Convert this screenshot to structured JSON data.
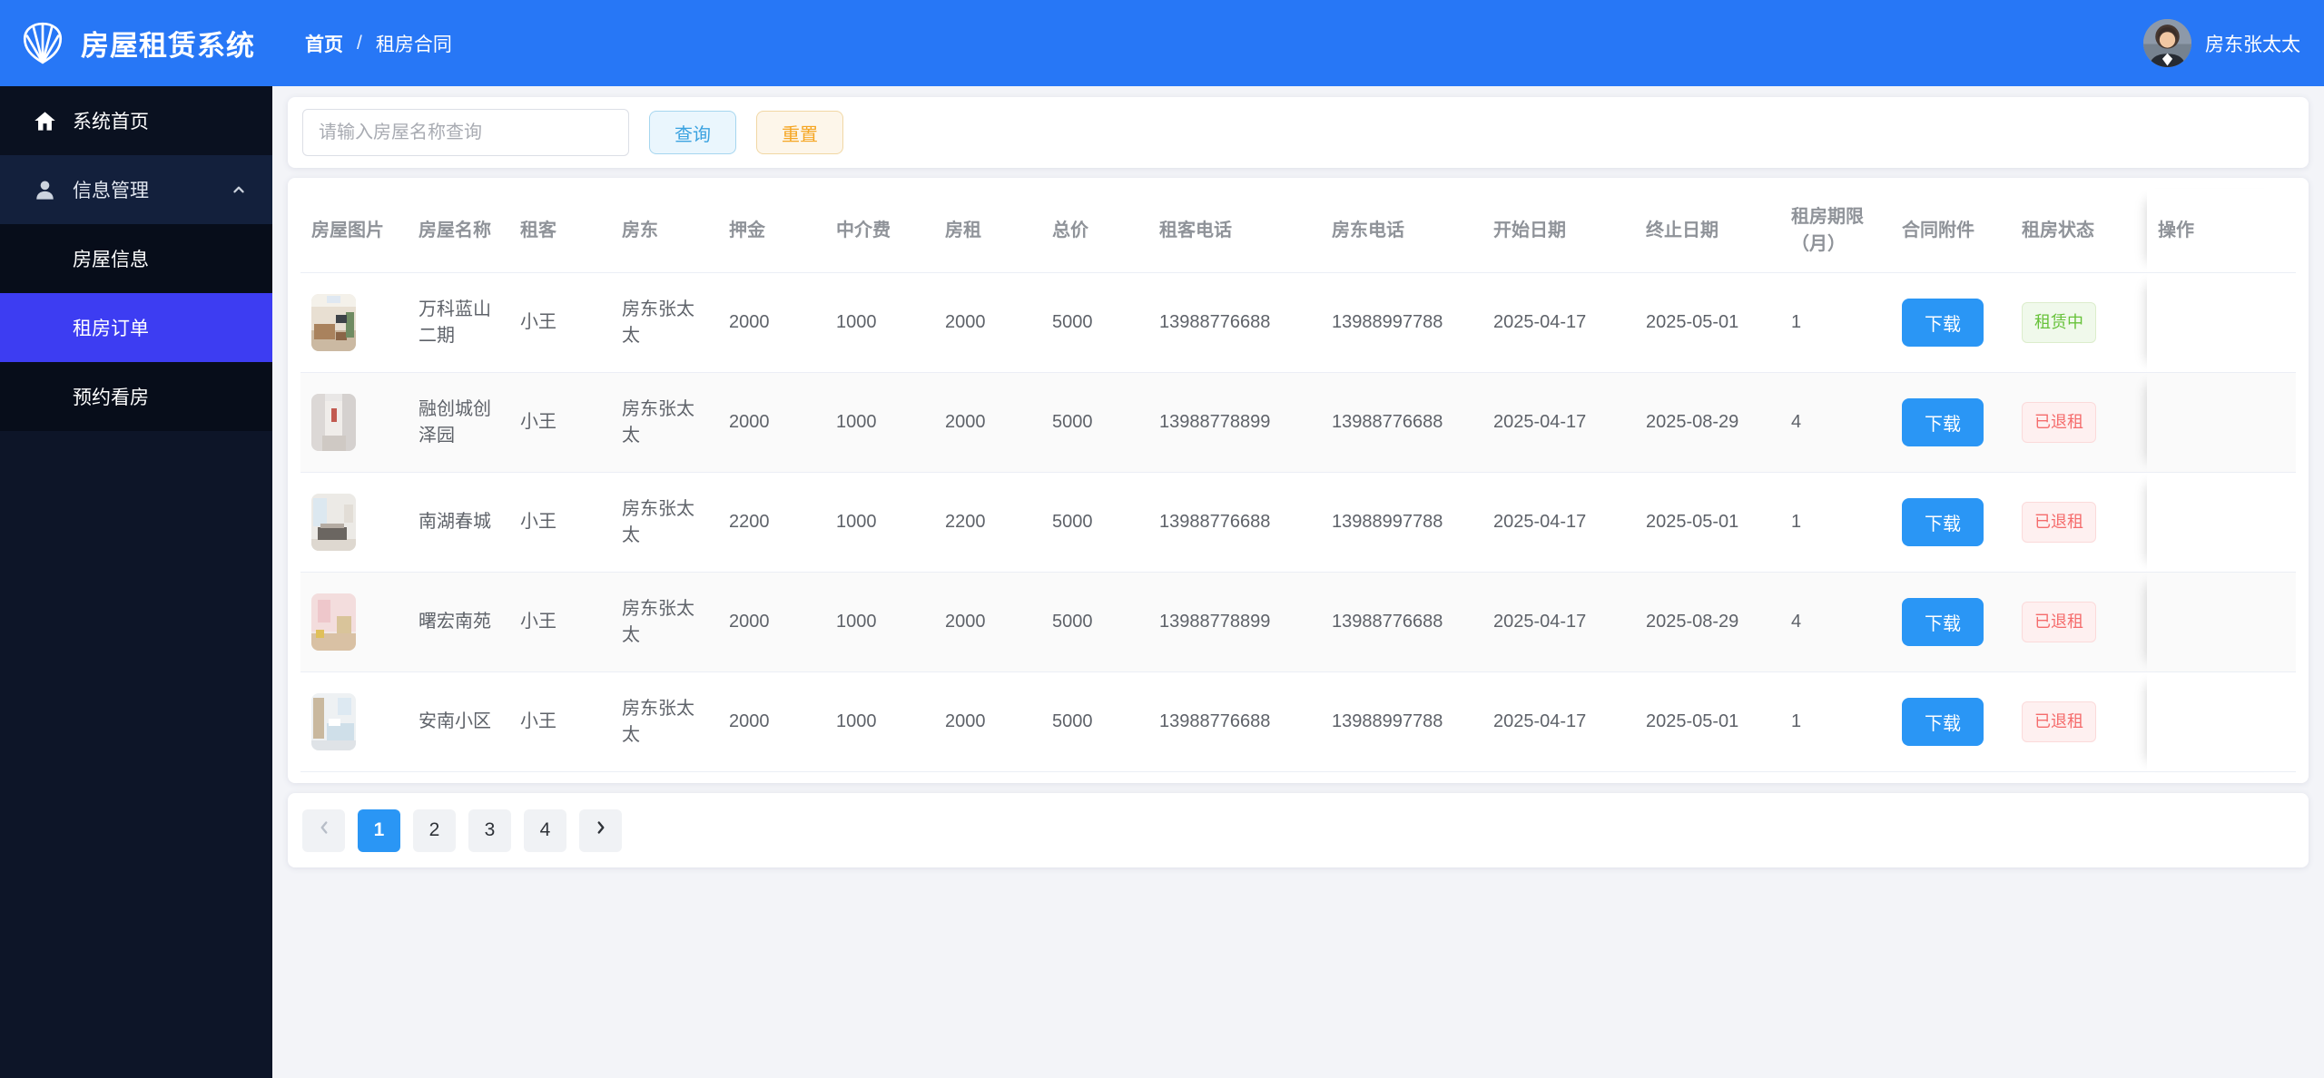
{
  "app": {
    "title": "房屋租赁系统",
    "logo_icon": "shell-logo-icon"
  },
  "header": {
    "breadcrumb": [
      "首页",
      "租房合同"
    ],
    "breadcrumb_separator": "/",
    "user_name": "房东张太太",
    "avatar": "user-avatar-photo"
  },
  "sidebar": {
    "items": [
      {
        "key": "system-home",
        "label": "系统首页",
        "icon": "home-icon"
      },
      {
        "key": "info-management",
        "label": "信息管理",
        "icon": "user-icon",
        "expanded": true,
        "chevron": "chevron-up-icon",
        "children": [
          {
            "key": "house-info",
            "label": "房屋信息"
          },
          {
            "key": "rental-orders",
            "label": "租房订单",
            "active": true
          },
          {
            "key": "viewing-appointments",
            "label": "预约看房"
          }
        ]
      }
    ]
  },
  "search": {
    "placeholder": "请输入房屋名称查询",
    "value": "",
    "query_label": "查询",
    "reset_label": "重置"
  },
  "table": {
    "columns": [
      "房屋图片",
      "房屋名称",
      "租客",
      "房东",
      "押金",
      "中介费",
      "房租",
      "总价",
      "租客电话",
      "房东电话",
      "开始日期",
      "终止日期",
      "租房期限（月）",
      "合同附件",
      "租房状态",
      "操作"
    ],
    "download_label": "下载",
    "rows": [
      {
        "photo": "house-photo",
        "name": "万科蓝山二期",
        "tenant": "小王",
        "landlord": "房东张太太",
        "deposit": "2000",
        "agency_fee": "1000",
        "rent": "2000",
        "total": "5000",
        "tenant_phone": "13988776688",
        "landlord_phone": "13988997788",
        "start_date": "2025-04-17",
        "end_date": "2025-05-01",
        "term_months": "1",
        "status": {
          "label": "租赁中",
          "type": "success"
        }
      },
      {
        "photo": "house-photo",
        "name": "融创城创泽园",
        "tenant": "小王",
        "landlord": "房东张太太",
        "deposit": "2000",
        "agency_fee": "1000",
        "rent": "2000",
        "total": "5000",
        "tenant_phone": "13988778899",
        "landlord_phone": "13988776688",
        "start_date": "2025-04-17",
        "end_date": "2025-08-29",
        "term_months": "4",
        "status": {
          "label": "已退租",
          "type": "danger"
        }
      },
      {
        "photo": "house-photo",
        "name": "南湖春城",
        "tenant": "小王",
        "landlord": "房东张太太",
        "deposit": "2200",
        "agency_fee": "1000",
        "rent": "2200",
        "total": "5000",
        "tenant_phone": "13988776688",
        "landlord_phone": "13988997788",
        "start_date": "2025-04-17",
        "end_date": "2025-05-01",
        "term_months": "1",
        "status": {
          "label": "已退租",
          "type": "danger"
        }
      },
      {
        "photo": "house-photo",
        "name": "曙宏南苑",
        "tenant": "小王",
        "landlord": "房东张太太",
        "deposit": "2000",
        "agency_fee": "1000",
        "rent": "2000",
        "total": "5000",
        "tenant_phone": "13988778899",
        "landlord_phone": "13988776688",
        "start_date": "2025-04-17",
        "end_date": "2025-08-29",
        "term_months": "4",
        "status": {
          "label": "已退租",
          "type": "danger"
        }
      },
      {
        "photo": "house-photo",
        "name": "安南小区",
        "tenant": "小王",
        "landlord": "房东张太太",
        "deposit": "2000",
        "agency_fee": "1000",
        "rent": "2000",
        "total": "5000",
        "tenant_phone": "13988776688",
        "landlord_phone": "13988997788",
        "start_date": "2025-04-17",
        "end_date": "2025-05-01",
        "term_months": "1",
        "status": {
          "label": "已退租",
          "type": "danger"
        }
      }
    ]
  },
  "pagination": {
    "prev_icon": "chevron-left-icon",
    "next_icon": "chevron-right-icon",
    "pages": [
      "1",
      "2",
      "3",
      "4"
    ],
    "active_page": "1"
  },
  "colors": {
    "header_blue": "#2777f6",
    "sidebar_dark": "#0d1528",
    "sidebar_active": "#3d3df2",
    "primary_button": "#2a96f5",
    "status_renting_green": "#67c23a",
    "status_returned_red": "#f56c6c",
    "query_button_blue": "#3aa2e0",
    "reset_button_orange": "#f5a623"
  }
}
